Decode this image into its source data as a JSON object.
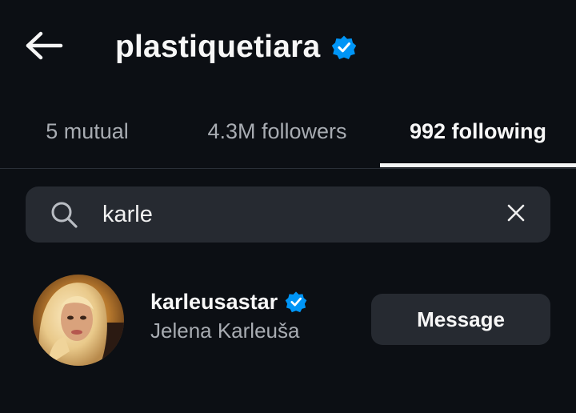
{
  "header": {
    "back_icon": "arrow-left-icon",
    "title": "plastiquetiara",
    "verified_icon": "verified-badge-icon"
  },
  "tabs": [
    {
      "label": "5 mutual",
      "active": false
    },
    {
      "label": "4.3M followers",
      "active": false
    },
    {
      "label": "992 following",
      "active": true
    }
  ],
  "search": {
    "icon": "search-icon",
    "value": "karle",
    "clear_icon": "close-icon"
  },
  "results": [
    {
      "username": "karleusastar",
      "full_name": "Jelena Karleuša",
      "verified": true,
      "action_label": "Message"
    }
  ],
  "colors": {
    "background": "#0c0f14",
    "surface": "#262a31",
    "verified": "#0095f6",
    "muted_text": "#a8acb2"
  }
}
